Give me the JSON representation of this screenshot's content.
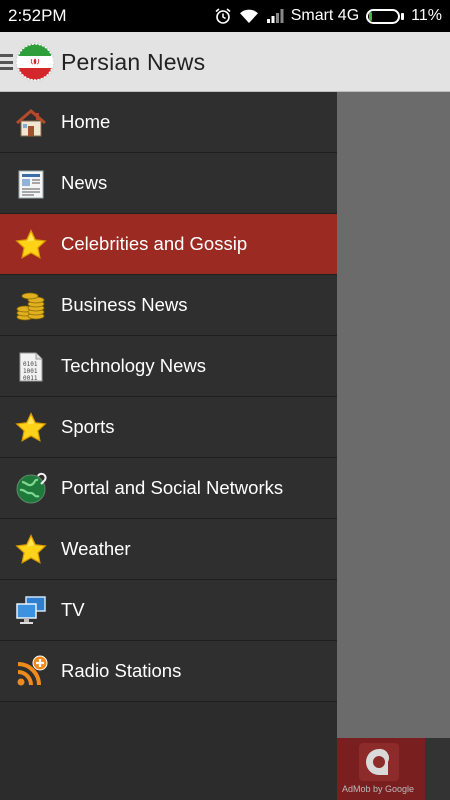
{
  "status_bar": {
    "time": "2:52PM",
    "carrier": "Smart 4G",
    "battery_percent": "11%",
    "battery_level": 0.11,
    "icons": [
      "alarm-icon",
      "wifi-icon",
      "signal-icon",
      "battery-icon"
    ]
  },
  "app_bar": {
    "title": "Persian News",
    "menu_icon": "hamburger-icon",
    "logo": "iran-flag-logo"
  },
  "drawer": {
    "selected_index": 2,
    "items": [
      {
        "label": "Home",
        "icon": "house-icon"
      },
      {
        "label": "News",
        "icon": "newspaper-icon"
      },
      {
        "label": "Celebrities and Gossip",
        "icon": "star-icon"
      },
      {
        "label": "Business News",
        "icon": "coins-icon"
      },
      {
        "label": "Technology News",
        "icon": "binary-document-icon"
      },
      {
        "label": "Sports",
        "icon": "star-icon"
      },
      {
        "label": "Portal and Social Networks",
        "icon": "globe-icon"
      },
      {
        "label": "Weather",
        "icon": "star-icon"
      },
      {
        "label": "TV",
        "icon": "monitors-icon"
      },
      {
        "label": "Radio Stations",
        "icon": "rss-add-icon"
      }
    ]
  },
  "ad": {
    "text": "AdMob by Google",
    "icon": "admob-icon"
  },
  "colors": {
    "active_item": "#9b2a22",
    "drawer_bg": "#2f2f2f",
    "app_bar_bg": "#e3e3e3",
    "battery_fill": "#4caf50"
  }
}
